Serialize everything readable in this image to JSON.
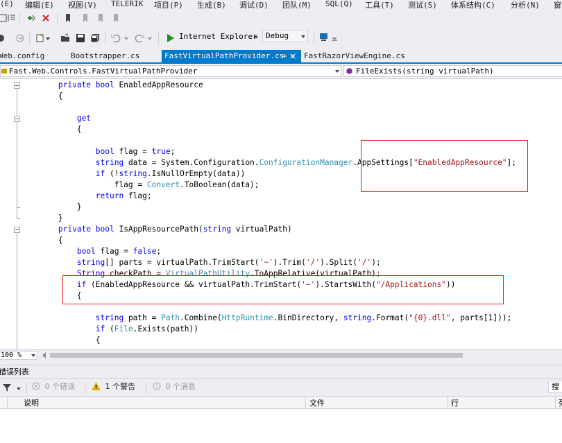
{
  "menu": [
    "(E)",
    "编辑(E)",
    "视图(V)",
    "TELERIK",
    "项目(P)",
    "生成(B)",
    "调试(D)",
    "团队(M)",
    "SQL(Q)",
    "工具(T)",
    "测试(S)",
    "体系结构(C)",
    "分析(N)",
    "窗"
  ],
  "toolbar": {
    "run_target": "Internet Explorer",
    "config": "Debug"
  },
  "tabs": [
    "Web.config",
    "Bootstrapper.cs",
    "FastVirtualPathProvider.cs",
    "FastRazorViewEngine.cs"
  ],
  "navbar": {
    "type_path": "Fast.Web.Controls.FastVirtualPathProvider",
    "member": "FileExists(string virtualPath)"
  },
  "code": [
    "        private bool EnabledAppResource",
    "        {",
    "",
    "            get",
    "            {",
    "",
    "                bool flag = true;",
    "                string data = System.Configuration.ConfigurationManager.AppSettings[\"EnabledAppResource\"];",
    "                if (!string.IsNullOrEmpty(data))",
    "                    flag = Convert.ToBoolean(data);",
    "                return flag;",
    "            }",
    "        }",
    "        private bool IsAppResourcePath(string virtualPath)",
    "        {",
    "            bool flag = false;",
    "            string[] parts = virtualPath.TrimStart('~').Trim('/').Split('/');",
    "            String checkPath = VirtualPathUtility.ToAppRelative(virtualPath);",
    "            if (EnabledAppResource && virtualPath.TrimStart('~').StartsWith(\"/Applications\"))",
    "            {",
    "",
    "                string path = Path.Combine(HttpRuntime.BinDirectory, string.Format(\"{0}.dll\", parts[1]));",
    "                if (File.Exists(path))",
    "                {"
  ],
  "zoom": "100 %",
  "error_list": {
    "title": "错误列表",
    "errors": "0 个错误",
    "warnings": "1 个警告",
    "messages": "0 个消息",
    "search": "搜",
    "columns": [
      "说明",
      "文件",
      "行",
      "列"
    ]
  },
  "colors": {
    "accent": "#007acc",
    "highlight_box": "#e02020"
  }
}
